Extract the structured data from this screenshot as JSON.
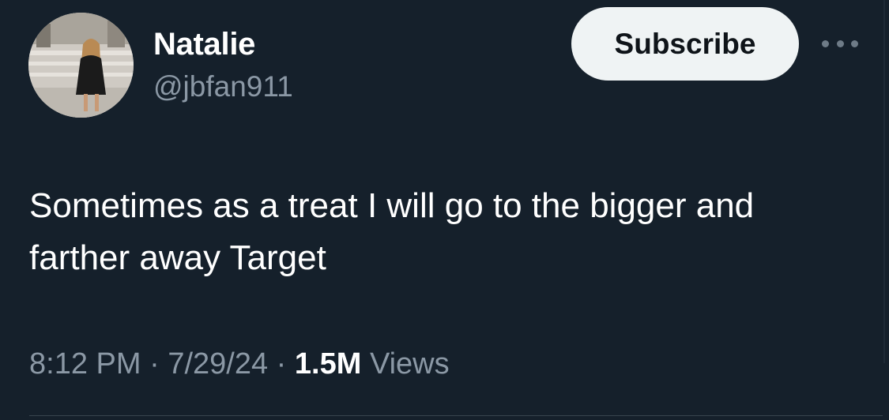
{
  "author": {
    "display_name": "Natalie",
    "handle": "@jbfan911"
  },
  "actions": {
    "subscribe_label": "Subscribe",
    "more_icon": "more-horizontal-icon"
  },
  "tweet": {
    "text": "Sometimes as a treat I will go to the bigger and farther away Target",
    "time": "8:12 PM",
    "date": "7/29/24",
    "separator": "·",
    "views_count": "1.5M",
    "views_label": "Views"
  },
  "colors": {
    "background": "#15202b",
    "primary_text": "#ffffff",
    "secondary_text": "#8b98a5",
    "subscribe_bg": "#eff3f4",
    "subscribe_text": "#0f1419"
  }
}
